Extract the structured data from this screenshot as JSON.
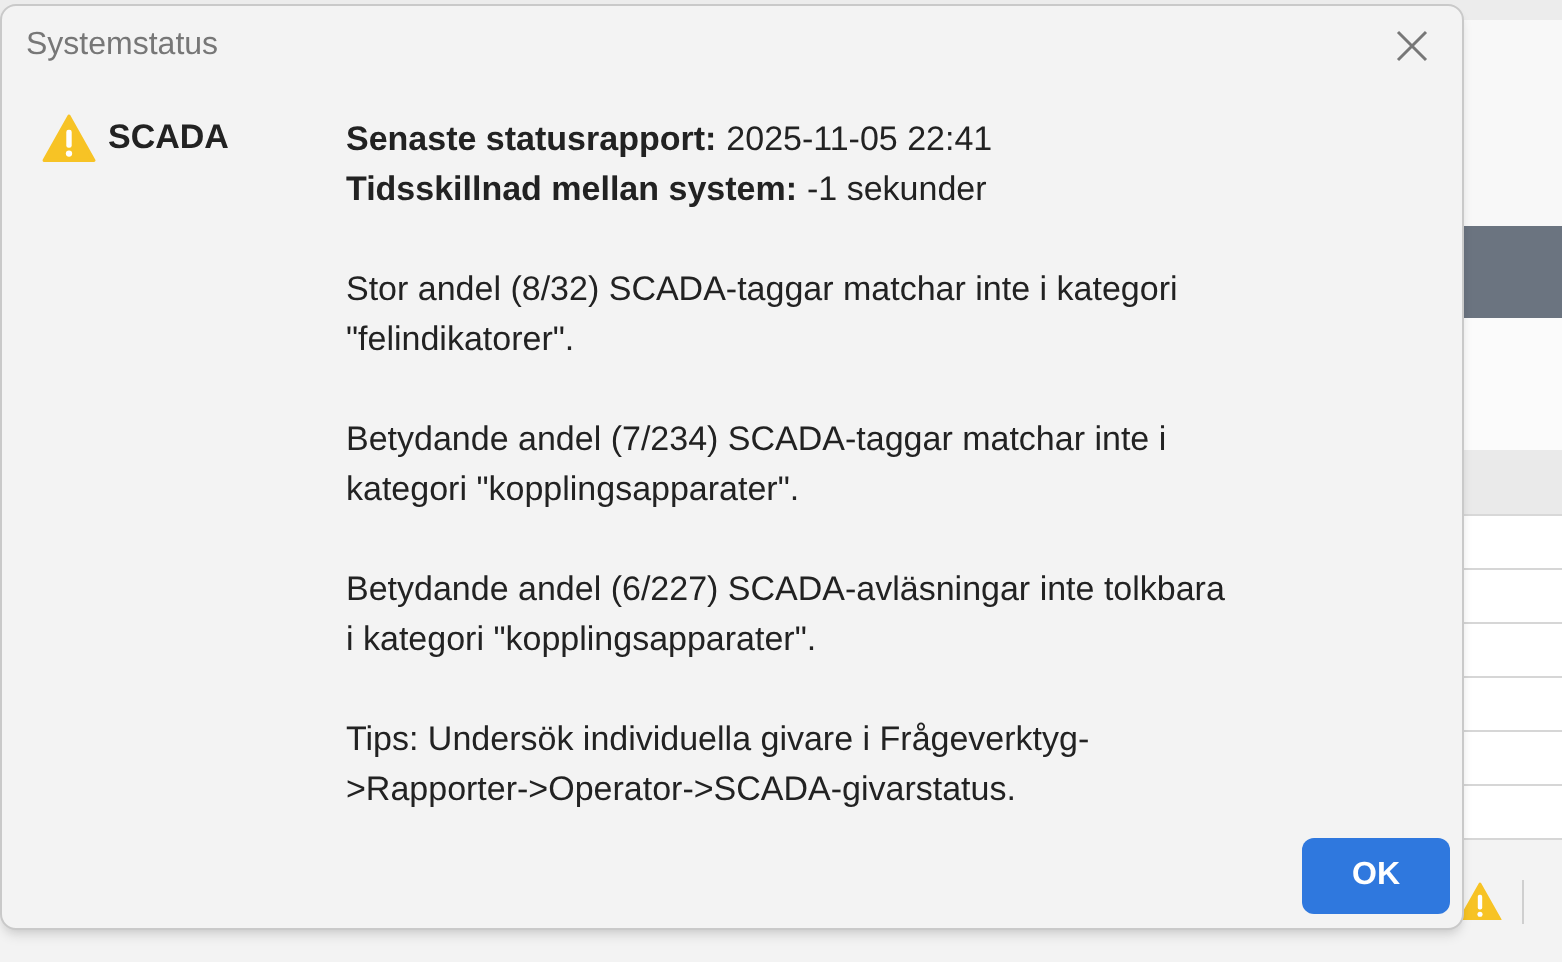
{
  "dialog": {
    "title": "Systemstatus",
    "source": {
      "label": "SCADA"
    },
    "fields": [
      {
        "label": "Senaste statusrapport:",
        "value": "2025-11-05 22:41"
      },
      {
        "label": "Tidsskillnad mellan system:",
        "value": "-1 sekunder"
      }
    ],
    "paragraphs": [
      "Stor andel (8/32) SCADA-taggar matchar inte i kategori \"felindikatorer\".",
      "Betydande andel (7/234) SCADA-taggar matchar inte i kategori \"kopplingsapparater\".",
      "Betydande andel (6/227) SCADA-avläsningar inte tolkbara i kategori \"kopplingsapparater\".",
      "Tips: Undersök individuella givare i Frågeverktyg->Rapporter->Operator->SCADA-givarstatus."
    ],
    "button": "OK"
  }
}
